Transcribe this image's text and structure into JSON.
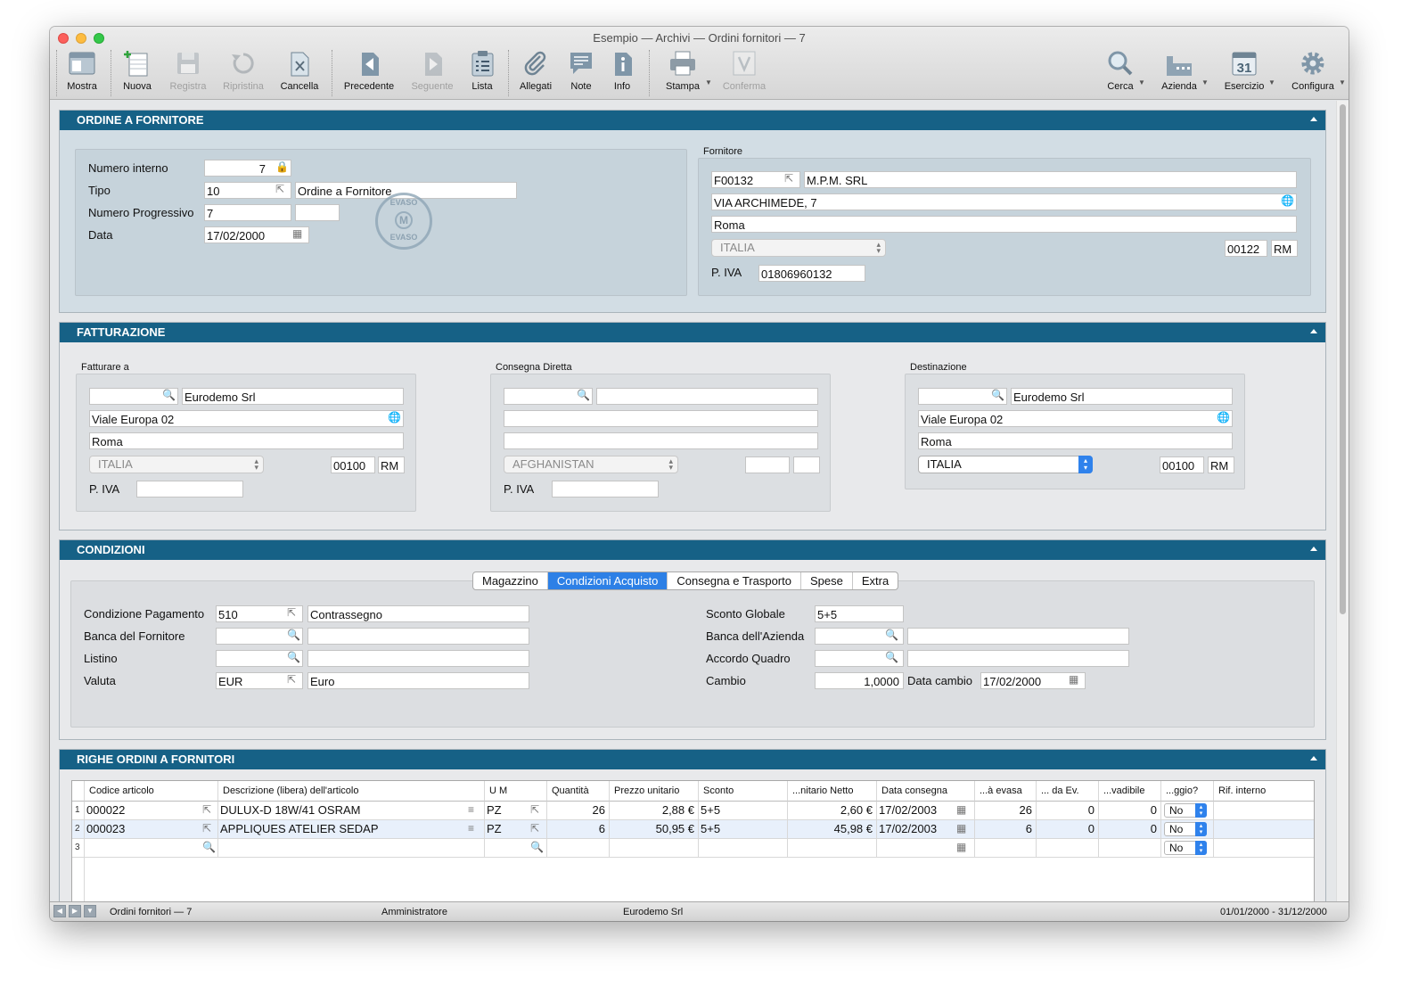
{
  "window": {
    "title": "Esempio — Archivi — Ordini fornitori — 7"
  },
  "toolbar": {
    "mostra": "Mostra",
    "nuova": "Nuova",
    "registra": "Registra",
    "ripristina": "Ripristina",
    "cancella": "Cancella",
    "precedente": "Precedente",
    "seguente": "Seguente",
    "lista": "Lista",
    "allegati": "Allegati",
    "note": "Note",
    "info": "Info",
    "stampa": "Stampa",
    "conferma": "Conferma",
    "cerca": "Cerca",
    "azienda": "Azienda",
    "esercizio": "Esercizio",
    "esercizio_day": "31",
    "configura": "Configura"
  },
  "ordine": {
    "header": "ORDINE A FORNITORE",
    "stamp_top": "EVASO",
    "stamp_mid": "M",
    "stamp_bottom": "EVASO",
    "numero_interno_label": "Numero interno",
    "numero_interno": "7",
    "tipo_label": "Tipo",
    "tipo_code": "10",
    "tipo_desc": "Ordine a Fornitore",
    "numero_progressivo_label": "Numero Progressivo",
    "numero_progressivo": "7",
    "numero_progressivo_suffix": "",
    "data_label": "Data",
    "data": "17/02/2000"
  },
  "fornitore": {
    "title": "Fornitore",
    "code": "F00132",
    "name": "M.P.M. SRL",
    "address": "VIA ARCHIMEDE, 7",
    "city": "Roma",
    "country": "ITALIA",
    "cap": "00122",
    "province": "RM",
    "piva_label": "P. IVA",
    "piva": "01806960132"
  },
  "fatturazione": {
    "header": "FATTURAZIONE",
    "fatturare": {
      "title": "Fatturare a",
      "code": "",
      "name": "Eurodemo Srl",
      "address": "Viale Europa 02",
      "city": "Roma",
      "country": "ITALIA",
      "cap": "00100",
      "province": "RM",
      "piva_label": "P. IVA",
      "piva": ""
    },
    "consegna": {
      "title": "Consegna Diretta",
      "code": "",
      "name": "",
      "address": "",
      "city": "",
      "country": "AFGHANISTAN",
      "cap": "",
      "province": "",
      "piva_label": "P. IVA",
      "piva": ""
    },
    "destinazione": {
      "title": "Destinazione",
      "code": "",
      "name": "Eurodemo Srl",
      "address": "Viale Europa 02",
      "city": "Roma",
      "country": "ITALIA",
      "cap": "00100",
      "province": "RM"
    }
  },
  "condizioni": {
    "header": "CONDIZIONI",
    "tabs": [
      "Magazzino",
      "Condizioni Acquisto",
      "Consegna e Trasporto",
      "Spese",
      "Extra"
    ],
    "pagamento_label": "Condizione Pagamento",
    "pagamento_code": "510",
    "pagamento_desc": "Contrassegno",
    "banca_fornitore_label": "Banca del Fornitore",
    "banca_fornitore_code": "",
    "banca_fornitore_desc": "",
    "listino_label": "Listino",
    "listino_code": "",
    "listino_desc": "",
    "valuta_label": "Valuta",
    "valuta_code": "EUR",
    "valuta_desc": "Euro",
    "sconto_label": "Sconto Globale",
    "sconto": "5+5",
    "banca_azienda_label": "Banca dell'Azienda",
    "banca_azienda_code": "",
    "banca_azienda_desc": "",
    "accordo_label": "Accordo Quadro",
    "accordo_code": "",
    "accordo_desc": "",
    "cambio_label": "Cambio",
    "cambio": "1,0000",
    "data_cambio_label": "Data cambio",
    "data_cambio": "17/02/2000"
  },
  "righe": {
    "header": "RIGHE ORDINI A FORNITORI",
    "columns": [
      "Codice articolo",
      "Descrizione (libera) dell'articolo",
      "U M",
      "Quantità",
      "Prezzo unitario",
      "Sconto",
      "...nitario Netto",
      "Data consegna",
      "...à evasa",
      "... da Ev.",
      "...vadibile",
      "...ggio?",
      "Rif. interno"
    ],
    "rows": [
      {
        "n": "1",
        "codice": "000022",
        "descrizione": "DULUX-D 18W/41 OSRAM",
        "um": "PZ",
        "quantita": "26",
        "prezzo": "2,88 €",
        "sconto": "5+5",
        "netto": "2,60 €",
        "data": "17/02/2003",
        "evasa": "26",
        "daev": "0",
        "evadibile": "0",
        "omaggio": "No",
        "rif": ""
      },
      {
        "n": "2",
        "codice": "000023",
        "descrizione": "APPLIQUES ATELIER SEDAP",
        "um": "PZ",
        "quantita": "6",
        "prezzo": "50,95 €",
        "sconto": "5+5",
        "netto": "45,98 €",
        "data": "17/02/2003",
        "evasa": "6",
        "daev": "0",
        "evadibile": "0",
        "omaggio": "No",
        "rif": ""
      },
      {
        "n": "3",
        "codice": "",
        "descrizione": "",
        "um": "",
        "quantita": "",
        "prezzo": "",
        "sconto": "",
        "netto": "",
        "data": "",
        "evasa": "",
        "daev": "",
        "evadibile": "",
        "omaggio": "No",
        "rif": ""
      }
    ]
  },
  "status": {
    "record": "Ordini fornitori — 7",
    "user": "Amministratore",
    "company": "Eurodemo Srl",
    "period": "01/01/2000 - 31/12/2000"
  },
  "colors": {
    "section_header": "#166186",
    "tab_active": "#2d80e6",
    "close": "#fc605c",
    "minimize": "#fdbc40",
    "zoom": "#34c84a"
  }
}
